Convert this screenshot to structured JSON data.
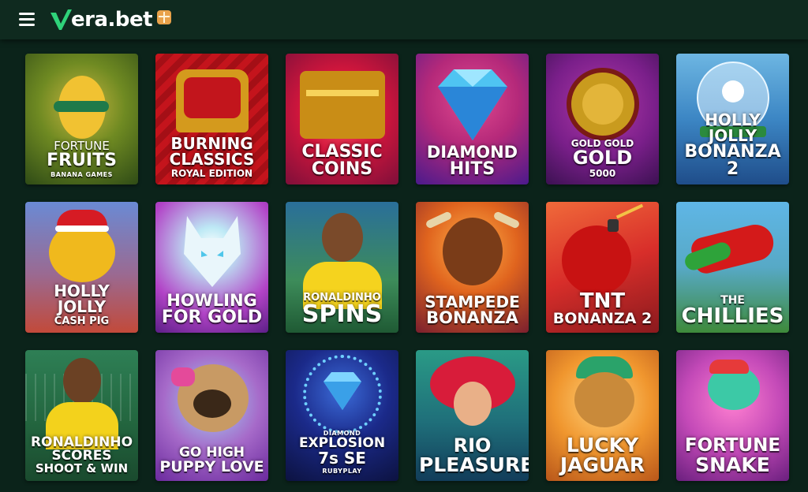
{
  "header": {
    "menu_icon": "hamburger-menu-icon",
    "logo_text": "era.bet",
    "logo_icon": "vera-v-logo-icon",
    "gift_icon": "gift-icon"
  },
  "games": [
    {
      "line1": "FORTUNE",
      "line2": "FRUITS",
      "line3": "",
      "provider": "BANANA GAMES"
    },
    {
      "line1": "BURNING",
      "line2": "CLASSICS",
      "line3": "ROYAL EDITION",
      "provider": ""
    },
    {
      "line1": "CLASSIC",
      "line2": "COINS",
      "line3": "",
      "provider": ""
    },
    {
      "line1": "DIAMOND",
      "line2": "HITS",
      "line3": "",
      "provider": ""
    },
    {
      "line1": "GOLD GOLD",
      "line2": "GOLD",
      "line3": "5000",
      "provider": ""
    },
    {
      "line1": "HOLLY JOLLY",
      "line2": "BONANZA 2",
      "line3": "",
      "provider": ""
    },
    {
      "line1": "HOLLY",
      "line2": "JOLLY",
      "line3": "CASH PIG",
      "provider": ""
    },
    {
      "line1": "HOWLING",
      "line2": "FOR GOLD",
      "line3": "",
      "provider": ""
    },
    {
      "line1": "RONALDINHO",
      "line2": "SPINS",
      "line3": "",
      "provider": ""
    },
    {
      "line1": "STAMPEDE",
      "line2": "BONANZA",
      "line3": "",
      "provider": ""
    },
    {
      "line1": "TNT",
      "line2": "BONANZA 2",
      "line3": "",
      "provider": ""
    },
    {
      "line1": "THE",
      "line2": "CHILLIES",
      "line3": "",
      "provider": ""
    },
    {
      "line1": "RONALDINHO",
      "line2": "SCORES",
      "line3": "SHOOT & WIN",
      "provider": ""
    },
    {
      "line1": "GO HIGH",
      "line2": "PUPPY LOVE",
      "line3": "",
      "provider": ""
    },
    {
      "line1": "DIAMOND",
      "line2": "EXPLOSION",
      "line3": "7s SE",
      "provider": "RUBYPLAY"
    },
    {
      "line1": "RIO",
      "line2": "PLEASURES",
      "line3": "",
      "provider": ""
    },
    {
      "line1": "LUCKY",
      "line2": "JAGUAR",
      "line3": "",
      "provider": ""
    },
    {
      "line1": "FORTUNE",
      "line2": "SNAKE",
      "line3": "",
      "provider": ""
    }
  ],
  "colors": {
    "page_bg": "#0b231a",
    "header_bg": "#0f2a1f",
    "logo_green": "#2fd37a",
    "gift_orange": "#e9a24a"
  }
}
